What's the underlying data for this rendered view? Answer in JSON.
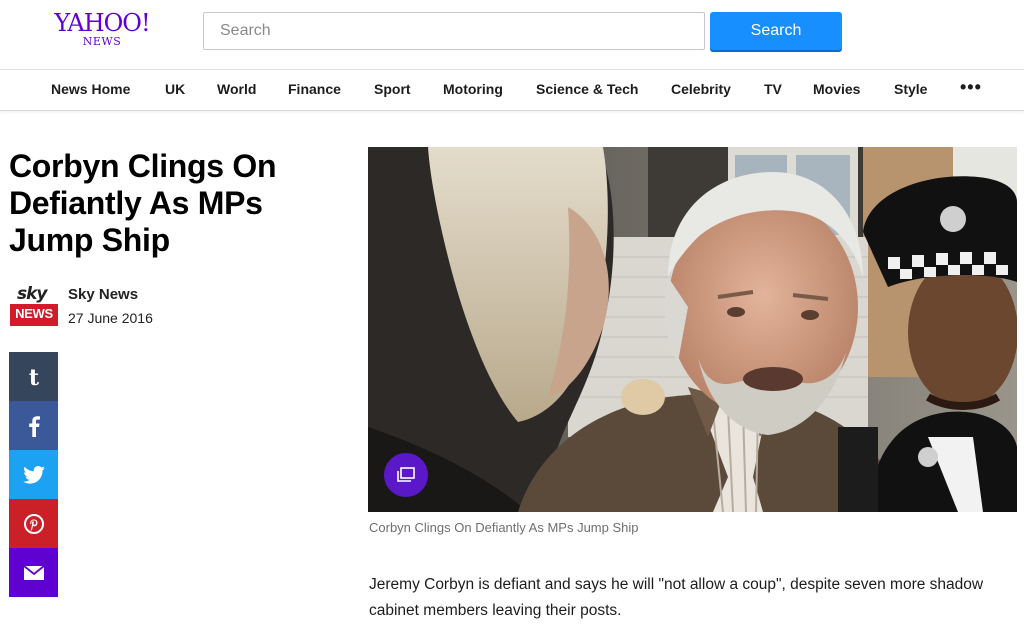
{
  "header": {
    "logo": {
      "brand": "YAHOO!",
      "sub": "NEWS"
    },
    "search": {
      "placeholder": "Search",
      "value": "",
      "button_label": "Search"
    },
    "accent_color": "#188fff",
    "brand_color": "#5f01d1"
  },
  "nav": {
    "items": [
      {
        "label": "News Home"
      },
      {
        "label": "UK"
      },
      {
        "label": "World"
      },
      {
        "label": "Finance"
      },
      {
        "label": "Sport"
      },
      {
        "label": "Motoring"
      },
      {
        "label": "Science & Tech"
      },
      {
        "label": "Celebrity"
      },
      {
        "label": "TV"
      },
      {
        "label": "Movies"
      },
      {
        "label": "Style"
      }
    ],
    "more_label": "•••"
  },
  "article": {
    "headline": "Corbyn Clings On Defiantly As MPs Jump Ship",
    "source": {
      "logo_top": "sky",
      "logo_bottom": "NEWS",
      "name": "Sky News",
      "date": "27 June 2016"
    },
    "share": [
      {
        "icon": "tumblr-icon",
        "color": "#35465c"
      },
      {
        "icon": "facebook-icon",
        "color": "#3b5998"
      },
      {
        "icon": "twitter-icon",
        "color": "#1da1f2"
      },
      {
        "icon": "pinterest-icon",
        "color": "#cb2027"
      },
      {
        "icon": "mail-icon",
        "color": "#5f01d1"
      }
    ],
    "image": {
      "gallery_icon": "gallery-icon"
    },
    "caption": "Corbyn Clings On Defiantly As MPs Jump Ship",
    "body": "Jeremy Corbyn is defiant and says he will \"not allow a coup\", despite seven more shadow cabinet members leaving their posts."
  }
}
